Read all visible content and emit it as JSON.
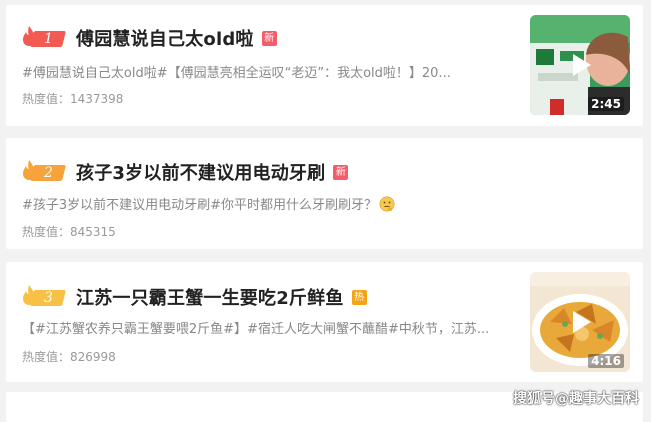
{
  "items": [
    {
      "rank": "1",
      "title": "傅园慧说自己太old啦",
      "badge": "新",
      "desc": "#傅园慧说自己太old啦#【傅园慧亮相全运叹“老迈”：我太old啦！】20...",
      "heat": "热度值：1437398",
      "video_duration": "2:45"
    },
    {
      "rank": "2",
      "title": "孩子3岁以前不建议用电动牙刷",
      "badge": "新",
      "desc": "#孩子3岁以前不建议用电动牙刷#你平时都用什么牙刷刷牙？",
      "heat": "热度值：845315"
    },
    {
      "rank": "3",
      "title": "江苏一只霸王蟹一生要吃2斤鲜鱼",
      "badge": "热",
      "desc": "【#江苏蟹农养只霸王蟹要喂2斤鱼#】#宿迁人吃大闸蟹不蘸醋#中秋节，江苏...",
      "heat": "热度值：826998",
      "video_duration": "4:16"
    }
  ],
  "watermark": "搜狐号@趣事大百科",
  "colors": {
    "rank1": "#f35a52",
    "rank2": "#f6a33c",
    "rank3": "#f7c145",
    "badge_new": "#f45c6a",
    "badge_hot": "#f3a316"
  }
}
